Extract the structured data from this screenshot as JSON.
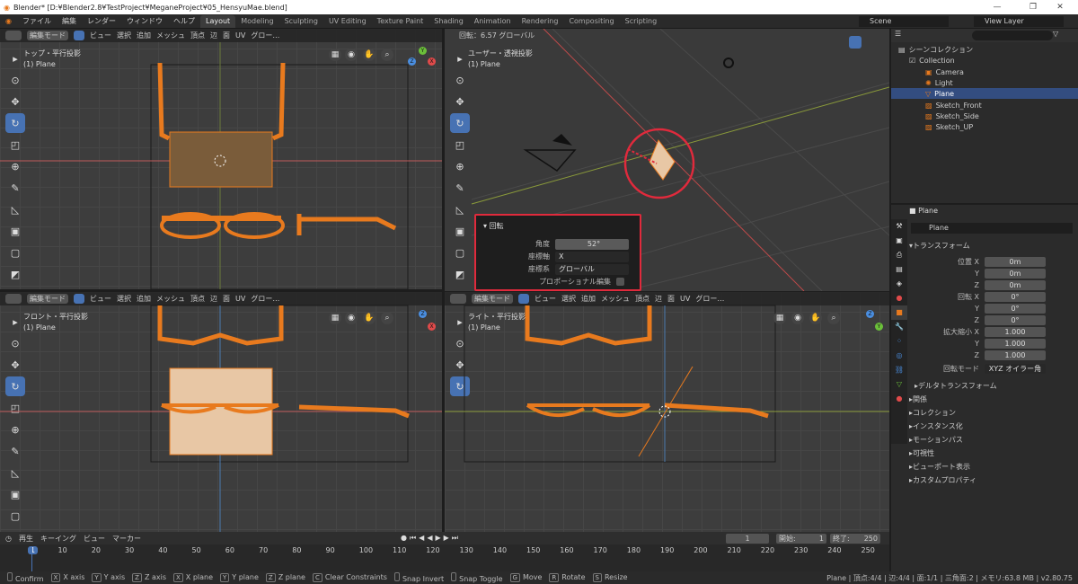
{
  "window": {
    "title": "Blender* [D:¥Blender2.8¥TestProject¥MeganeProject¥05_HensyuMae.blend]",
    "min": "—",
    "max": "❐",
    "close": "✕"
  },
  "menu": {
    "items": [
      "ファイル",
      "編集",
      "レンダー",
      "ウィンドウ",
      "ヘルプ"
    ],
    "workspaces": [
      "Layout",
      "Modeling",
      "Sculpting",
      "UV Editing",
      "Texture Paint",
      "Shading",
      "Animation",
      "Rendering",
      "Compositing",
      "Scripting"
    ],
    "scene": "Scene",
    "view_layer": "View Layer"
  },
  "header": {
    "mode": "編集モード",
    "items": [
      "ビュー",
      "選択",
      "追加",
      "メッシュ",
      "頂点",
      "辺",
      "面",
      "UV"
    ],
    "orient": "グロー…",
    "rotate_status": "回転：6.57 グローバル"
  },
  "viewports": {
    "top_left": {
      "title": "トップ・平行投影",
      "sub": "(1) Plane"
    },
    "top_right": {
      "title": "ユーザー・透視投影",
      "sub": "(1) Plane"
    },
    "bottom_left": {
      "title": "フロント・平行投影",
      "sub": "(1) Plane"
    },
    "bottom_right": {
      "title": "ライト・平行投影",
      "sub": "(1) Plane"
    }
  },
  "operator": {
    "title": "回転",
    "angle_label": "角度",
    "angle": "52°",
    "axis_label": "座標軸",
    "axis": "X",
    "orient_label": "座標系",
    "orient": "グローバル",
    "prop_label": "プロポーショナル編集"
  },
  "outliner": {
    "root": "シーンコレクション",
    "collection": "Collection",
    "items": [
      "Camera",
      "Light",
      "Plane",
      "Sketch_Front",
      "Sketch_Side",
      "Sketch_UP"
    ],
    "selected": "Plane"
  },
  "properties": {
    "object": "Plane",
    "mesh": "Plane",
    "transform": "トランスフォーム",
    "location_label": "位置 X",
    "rotation_label": "回転 X",
    "scale_label": "拡大縮小 X",
    "loc": [
      "0m",
      "0m",
      "0m"
    ],
    "rot": [
      "0°",
      "0°",
      "0°"
    ],
    "scale": [
      "1.000",
      "1.000",
      "1.000"
    ],
    "y": "Y",
    "z": "Z",
    "rot_mode_label": "回転モード",
    "rot_mode": "XYZ オイラー角",
    "delta": "デルタトランスフォーム",
    "panels": [
      "関係",
      "コレクション",
      "インスタンス化",
      "モーションパス",
      "可視性",
      "ビューポート表示",
      "カスタムプロパティ"
    ]
  },
  "timeline": {
    "menu": [
      "再生",
      "キーイング",
      "ビュー",
      "マーカー"
    ],
    "current": "1",
    "start_label": "開始:",
    "start": "1",
    "end_label": "終了:",
    "end": "250",
    "ticks": [
      "1",
      "10",
      "20",
      "30",
      "40",
      "50",
      "60",
      "70",
      "80",
      "90",
      "100",
      "110",
      "120",
      "130",
      "140",
      "150",
      "160",
      "170",
      "180",
      "190",
      "200",
      "210",
      "220",
      "230",
      "240",
      "250"
    ]
  },
  "status": {
    "items": [
      {
        "k": "",
        "t": "Confirm"
      },
      {
        "k": "X",
        "t": "X axis"
      },
      {
        "k": "Y",
        "t": "Y axis"
      },
      {
        "k": "Z",
        "t": "Z axis"
      },
      {
        "k": "X",
        "t": "X plane"
      },
      {
        "k": "Y",
        "t": "Y plane"
      },
      {
        "k": "Z",
        "t": "Z plane"
      },
      {
        "k": "C",
        "t": "Clear Constraints"
      },
      {
        "k": "",
        "t": "Snap Invert"
      },
      {
        "k": "",
        "t": "Snap Toggle"
      },
      {
        "k": "G",
        "t": "Move"
      },
      {
        "k": "R",
        "t": "Rotate"
      },
      {
        "k": "S",
        "t": "Resize"
      }
    ],
    "info": "Plane | 頂点:4/4 | 辺:4/4 | 面:1/1 | 三角面:2 | メモリ:63.8 MB | v2.80.75"
  },
  "colors": {
    "accent": "#4772b3",
    "orange": "#e87a1e",
    "red": "#e02a3c"
  }
}
